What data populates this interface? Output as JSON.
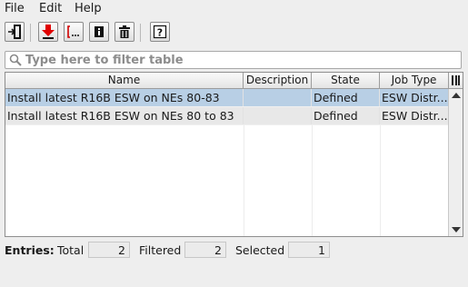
{
  "menu": {
    "file": "File",
    "edit": "Edit",
    "help": "Help"
  },
  "toolbar": {
    "buttons": [
      {
        "icon": "exit-icon"
      },
      {
        "icon": "download-red-icon"
      },
      {
        "icon": "bracket-ellipsis-icon"
      },
      {
        "icon": "info-icon"
      },
      {
        "icon": "trash-icon"
      },
      {
        "icon": "help-icon"
      }
    ]
  },
  "filter": {
    "placeholder": "Type here to filter table",
    "value": ""
  },
  "table": {
    "columns": [
      "Name",
      "Description",
      "State",
      "Job Type"
    ],
    "rows": [
      {
        "name": "Install latest R16B ESW on NEs 80-83",
        "description": "",
        "state": "Defined",
        "job_type": "ESW Distr...",
        "selected": true
      },
      {
        "name": "Install latest R16B ESW on NEs 80 to 83",
        "description": "",
        "state": "Defined",
        "job_type": "ESW Distr...",
        "selected": false
      }
    ]
  },
  "status": {
    "entries_label": "Entries:",
    "total_label": "Total",
    "total": "2",
    "filtered_label": "Filtered",
    "filtered": "2",
    "selected_label": "Selected",
    "selected": "1"
  }
}
